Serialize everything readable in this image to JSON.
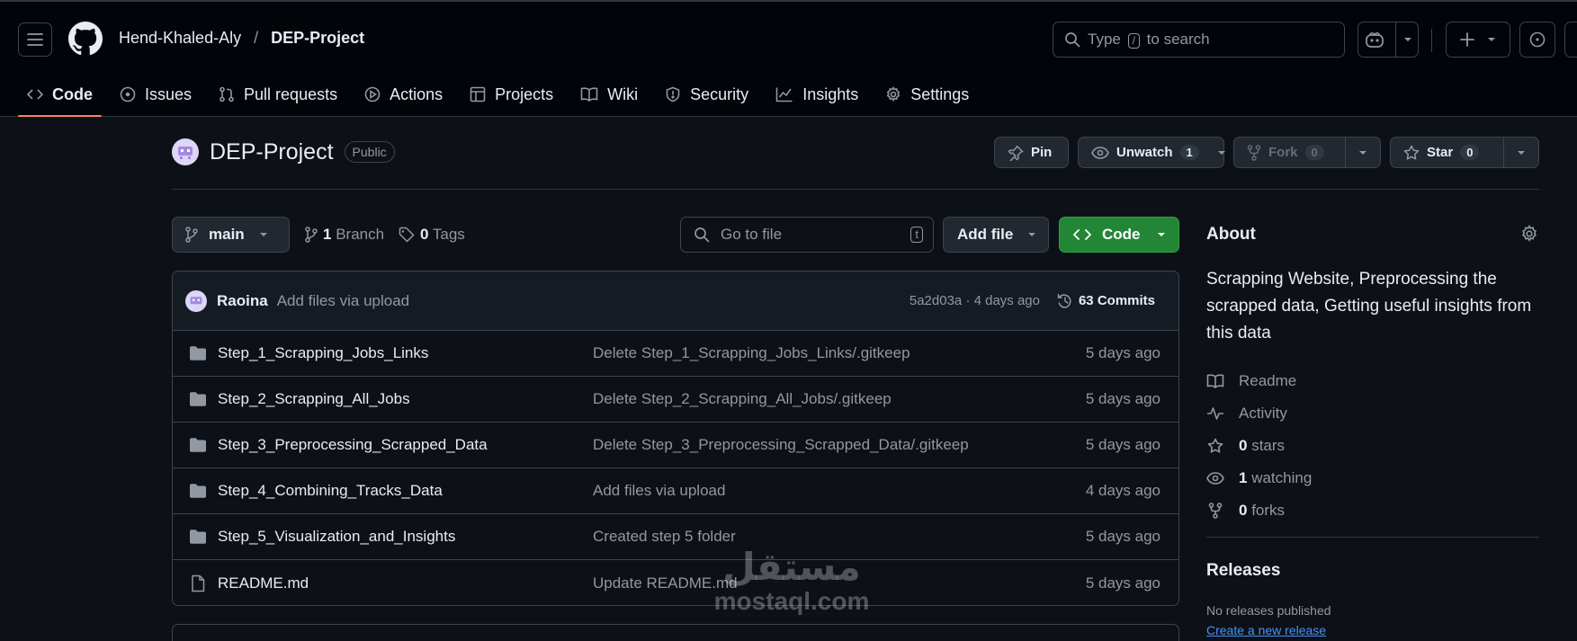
{
  "header": {
    "owner": "Hend-Khaled-Aly",
    "separator": "/",
    "repo": "DEP-Project",
    "search_prefix": "Type",
    "search_key": "/",
    "search_suffix": "to search"
  },
  "tabs": [
    {
      "label": "Code",
      "icon": "code-icon",
      "active": true
    },
    {
      "label": "Issues",
      "icon": "issue-icon"
    },
    {
      "label": "Pull requests",
      "icon": "pull-request-icon"
    },
    {
      "label": "Actions",
      "icon": "play-icon"
    },
    {
      "label": "Projects",
      "icon": "table-icon"
    },
    {
      "label": "Wiki",
      "icon": "book-icon"
    },
    {
      "label": "Security",
      "icon": "shield-icon"
    },
    {
      "label": "Insights",
      "icon": "graph-icon"
    },
    {
      "label": "Settings",
      "icon": "gear-icon"
    }
  ],
  "repo_head": {
    "name": "DEP-Project",
    "visibility": "Public",
    "pin_label": "Pin",
    "unwatch_label": "Unwatch",
    "watch_count": "1",
    "fork_label": "Fork",
    "fork_count": "0",
    "star_label": "Star",
    "star_count": "0"
  },
  "file_nav": {
    "branch": "main",
    "branch_count": "1",
    "branch_label": "Branch",
    "tag_count": "0",
    "tag_label": "Tags",
    "go_to_file": "Go to file",
    "go_to_file_key": "t",
    "add_file": "Add file",
    "code": "Code"
  },
  "latest_commit": {
    "author": "Raoina",
    "message": "Add files via upload",
    "sha_time": "5a2d03a · 4 days ago",
    "commits": "63 Commits"
  },
  "files": [
    {
      "name": "Step_1_Scrapping_Jobs_Links",
      "type": "folder",
      "message": "Delete Step_1_Scrapping_Jobs_Links/.gitkeep",
      "date": "5 days ago"
    },
    {
      "name": "Step_2_Scrapping_All_Jobs",
      "type": "folder",
      "message": "Delete Step_2_Scrapping_All_Jobs/.gitkeep",
      "date": "5 days ago"
    },
    {
      "name": "Step_3_Preprocessing_Scrapped_Data",
      "type": "folder",
      "message": "Delete Step_3_Preprocessing_Scrapped_Data/.gitkeep",
      "date": "5 days ago"
    },
    {
      "name": "Step_4_Combining_Tracks_Data",
      "type": "folder",
      "message": "Add files via upload",
      "date": "4 days ago"
    },
    {
      "name": "Step_5_Visualization_and_Insights",
      "type": "folder",
      "message": "Created step 5 folder",
      "date": "5 days ago"
    },
    {
      "name": "README.md",
      "type": "file",
      "message": "Update README.md",
      "date": "5 days ago"
    }
  ],
  "about": {
    "title": "About",
    "description": "Scrapping Website, Preprocessing the scrapped data, Getting useful insights from this data",
    "readme": "Readme",
    "activity": "Activity",
    "stars_count": "0",
    "stars_label": "stars",
    "watching_count": "1",
    "watching_label": "watching",
    "forks_count": "0",
    "forks_label": "forks"
  },
  "releases": {
    "title": "Releases",
    "none": "No releases published",
    "create_link": "Create a new release"
  },
  "watermark": {
    "arabic": "مستقل",
    "latin": "mostaql.com"
  },
  "colors": {
    "background": "#0d1117",
    "header_bg": "#010409",
    "accent_underline": "#f78166",
    "code_button": "#238636",
    "link": "#4493f8"
  }
}
